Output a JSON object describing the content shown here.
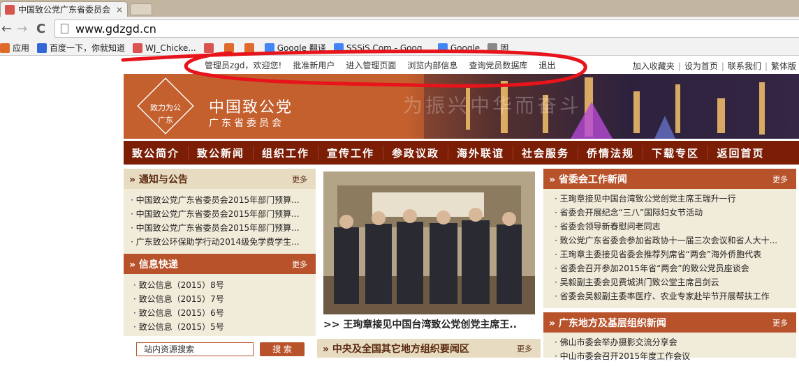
{
  "browser": {
    "tab_title": "中国致公党广东省委员会",
    "tab_close": "×",
    "url": "www.gdzgd.cn",
    "back": "←",
    "forward": "→",
    "reload": "C",
    "bookmarks": [
      {
        "label": "应用",
        "icon": "apps-icon",
        "color": "#e06a2b"
      },
      {
        "label": "百度一下，你就知道",
        "icon": "baidu-icon",
        "color": "#3367d6"
      },
      {
        "label": "WJ_Chicke...",
        "icon": "weibo-icon",
        "color": "#d9534f"
      },
      {
        "label": "",
        "icon": "bookmark-icon",
        "color": "#d9534f"
      },
      {
        "label": "",
        "icon": "bookmark-icon",
        "color": "#e06a2b"
      },
      {
        "label": "",
        "icon": "bookmark-icon",
        "color": "#e06a2b"
      },
      {
        "label": "Google 翻译",
        "icon": "google-translate-icon",
        "color": "#4285f4"
      },
      {
        "label": "SSSiS.Com - Goog...",
        "icon": "google-icon",
        "color": "#4285f4"
      },
      {
        "label": "Google",
        "icon": "google-icon",
        "color": "#4285f4"
      },
      {
        "label": "固",
        "icon": "page-icon",
        "color": "#888888"
      }
    ]
  },
  "site": {
    "admin_links": [
      "管理员zgd，欢迎您!",
      "批准新用户",
      "进入管理页面",
      "浏览内部信息",
      "查询党员数据库",
      "退出"
    ],
    "top_right": [
      "加入收藏夹",
      "设为首页",
      "联系我们",
      "繁体版"
    ],
    "logo_text": "致力为公",
    "logo_sub": "广东",
    "org_name": "中国致公党",
    "org_sub": "广东省委员会",
    "slogan": "为振兴中华而奋斗",
    "nav": [
      "致公简介",
      "致公新闻",
      "组织工作",
      "宣传工作",
      "参政议政",
      "海外联谊",
      "社会服务",
      "侨情法规",
      "下载专区",
      "返回首页"
    ],
    "notices": {
      "title": "通知与公告",
      "more": "更多",
      "items": [
        "中国致公党广东省委员会2015年部门预算...",
        "中国致公党广东省委员会2015年部门预算...",
        "中国致公党广东省委员会2015年部门预算...",
        "广东致公环保助学行动2014级免学费学生..."
      ]
    },
    "info": {
      "title": "信息快递",
      "more": "更多",
      "items": [
        "致公信息（2015）8号",
        "致公信息（2015）7号",
        "致公信息（2015）6号",
        "致公信息（2015）5号"
      ]
    },
    "search": {
      "placeholder": "站内资源搜索",
      "button": "搜 索"
    },
    "photo_caption": ">> 王珣章接见中国台湾致公党创党主席王..",
    "central": {
      "title": "中央及全国其它地方组织要闻区",
      "more": "更多"
    },
    "provincial": {
      "title": "省委会工作新闻",
      "more": "更多",
      "items": [
        "王珣章接见中国台湾致公党创党主席王瑞升一行",
        "省委会开展纪念“三八”国际妇女节活动",
        "省委会领导新春慰问老同志",
        "致公党广东省委会参加省政协十一届三次会议和省人大十...",
        "王珣章主委接见省委会推荐列席省“两会”海外侨胞代表",
        "省委会召开参加2015年省“两会”的致公党员座谈会",
        "吴毅副主委会见费城洪门致公堂主席吕剑云",
        "省委会吴毅副主委率医疗、农业专家赴毕节开展帮扶工作"
      ]
    },
    "local": {
      "title": "广东地方及基层组织新闻",
      "more": "更多",
      "items": [
        "佛山市委会举办摄影交流分享会",
        "中山市委会召开2015年度工作会议"
      ]
    }
  },
  "colors": {
    "brand_dark": "#7c1e06",
    "brand": "#b8522a",
    "annotation": "#e8141b"
  }
}
